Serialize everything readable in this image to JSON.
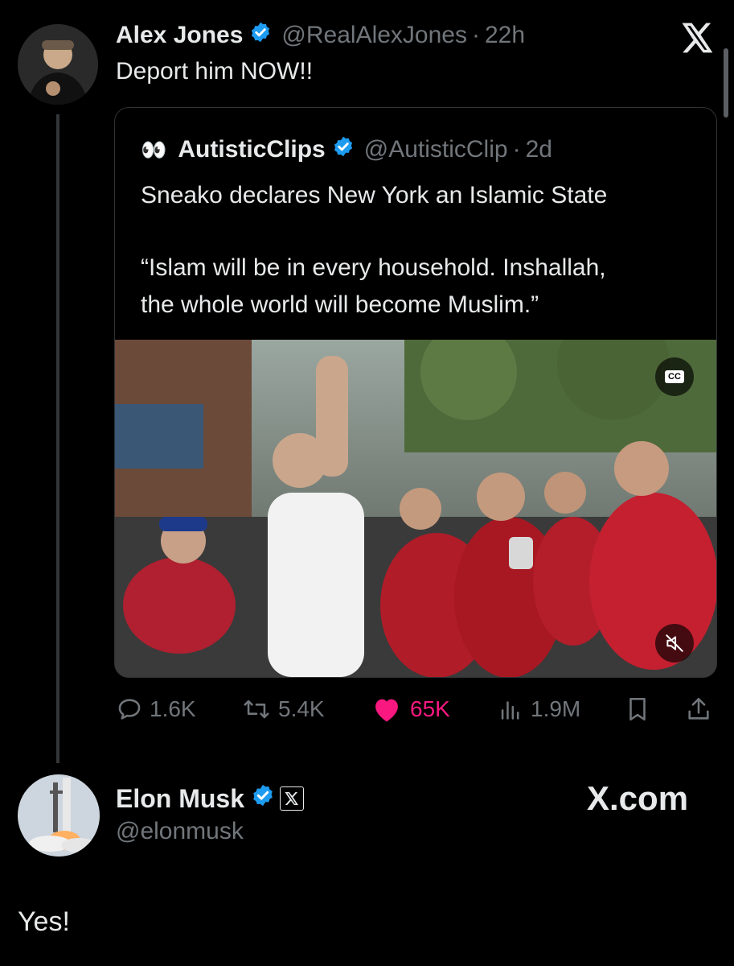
{
  "tweet": {
    "author_name": "Alex Jones",
    "handle": "@RealAlexJones",
    "time": "22h",
    "text": "Deport him NOW!!"
  },
  "quote": {
    "emoji": "👀",
    "author_name": "AutisticClips",
    "handle": "@AutisticClip",
    "time": "2d",
    "line1": "Sneako declares New York an Islamic State",
    "line2": "“Islam will be in every household. Inshallah,",
    "line3": "the whole world will become Muslim.”",
    "cc_label": "CC"
  },
  "actions": {
    "replies": "1.6K",
    "reposts": "5.4K",
    "likes": "65K",
    "views": "1.9M"
  },
  "reply": {
    "author_name": "Elon Musk",
    "handle": "@elonmusk",
    "text": "Yes!",
    "watermark": "X.com"
  },
  "colors": {
    "background": "#000000",
    "text": "#e7e9ea",
    "muted": "#71767b",
    "verified_blue": "#1d9bf0",
    "like_pink": "#f91880"
  }
}
